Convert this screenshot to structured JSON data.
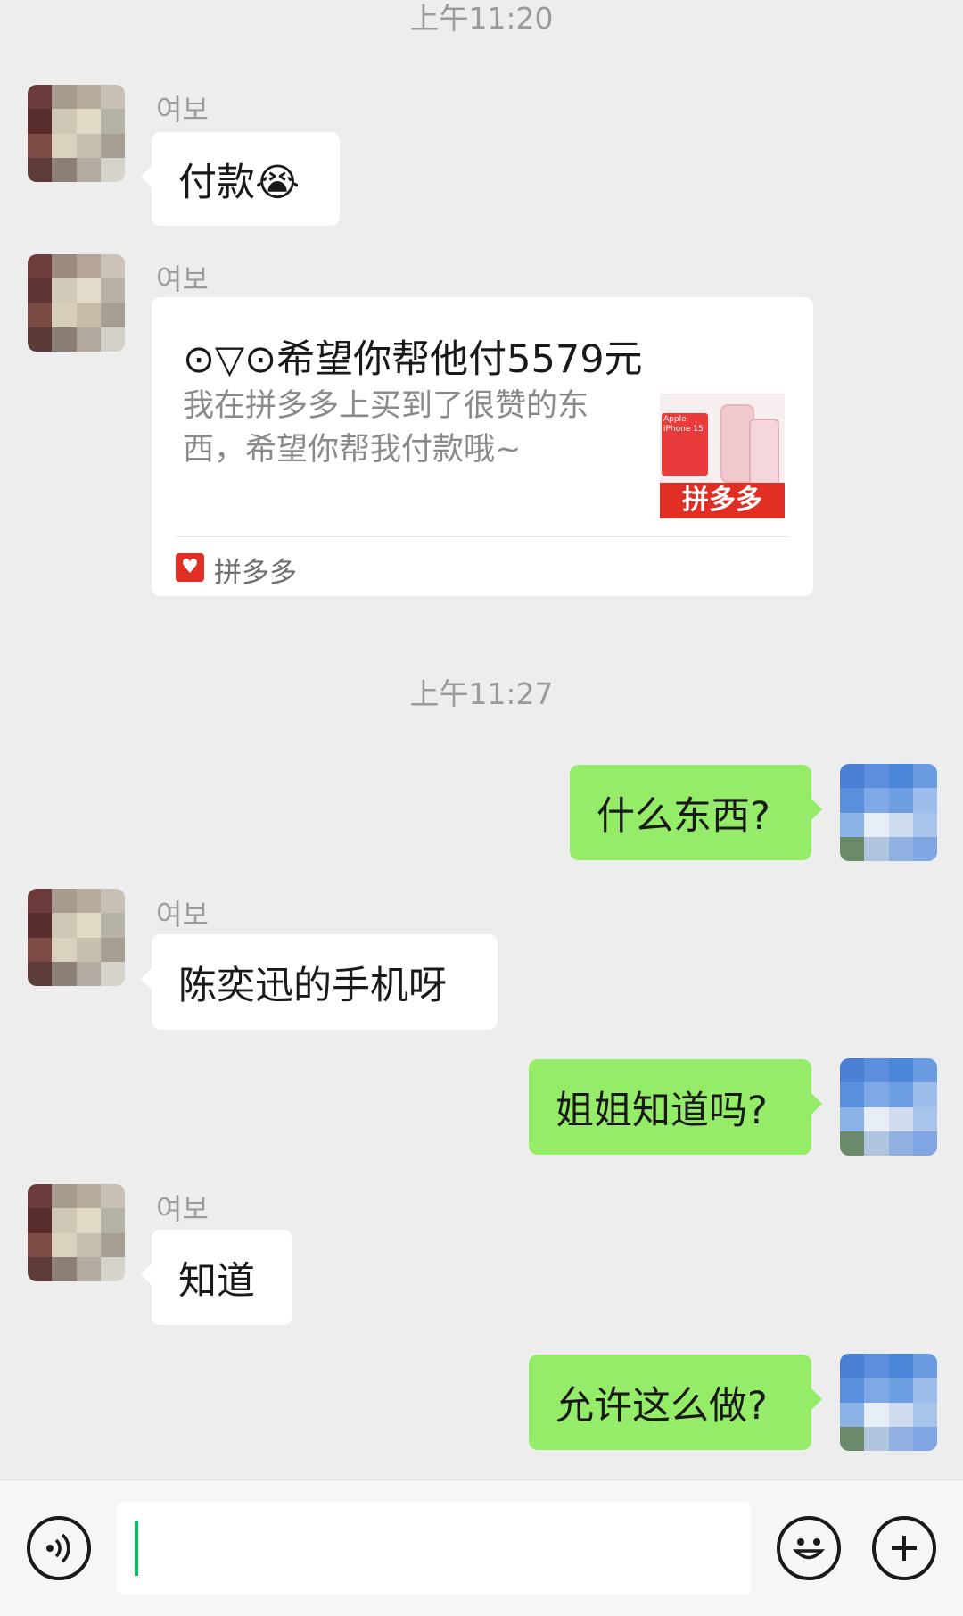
{
  "timestamps": [
    "上午11:20",
    "上午11:27"
  ],
  "contact": {
    "name": "여보"
  },
  "messages": [
    {
      "side": "left",
      "text": "付款😭"
    },
    {
      "side": "left",
      "type": "card",
      "title": "⊙▽⊙希望你帮他付5579元",
      "desc": "我在拼多多上买到了很赞的东西，希望你帮我付款哦~",
      "thumb_lines": [
        "Apple",
        "iPhone 15",
        "拼多多"
      ],
      "source": "拼多多"
    },
    {
      "side": "right",
      "text": "什么东西?"
    },
    {
      "side": "left",
      "text": "陈奕迅的手机呀"
    },
    {
      "side": "right",
      "text": "姐姐知道吗?"
    },
    {
      "side": "left",
      "text": "知道"
    },
    {
      "side": "right",
      "text": "允许这么做?"
    }
  ],
  "icons": {
    "voice": "voice-icon",
    "emoji": "emoji-icon",
    "more": "plus-icon"
  },
  "colors": {
    "background": "#ededed",
    "self_bubble": "#95ec69",
    "other_bubble": "#ffffff",
    "accent": "#07c160",
    "pdd_red": "#e02e24"
  }
}
